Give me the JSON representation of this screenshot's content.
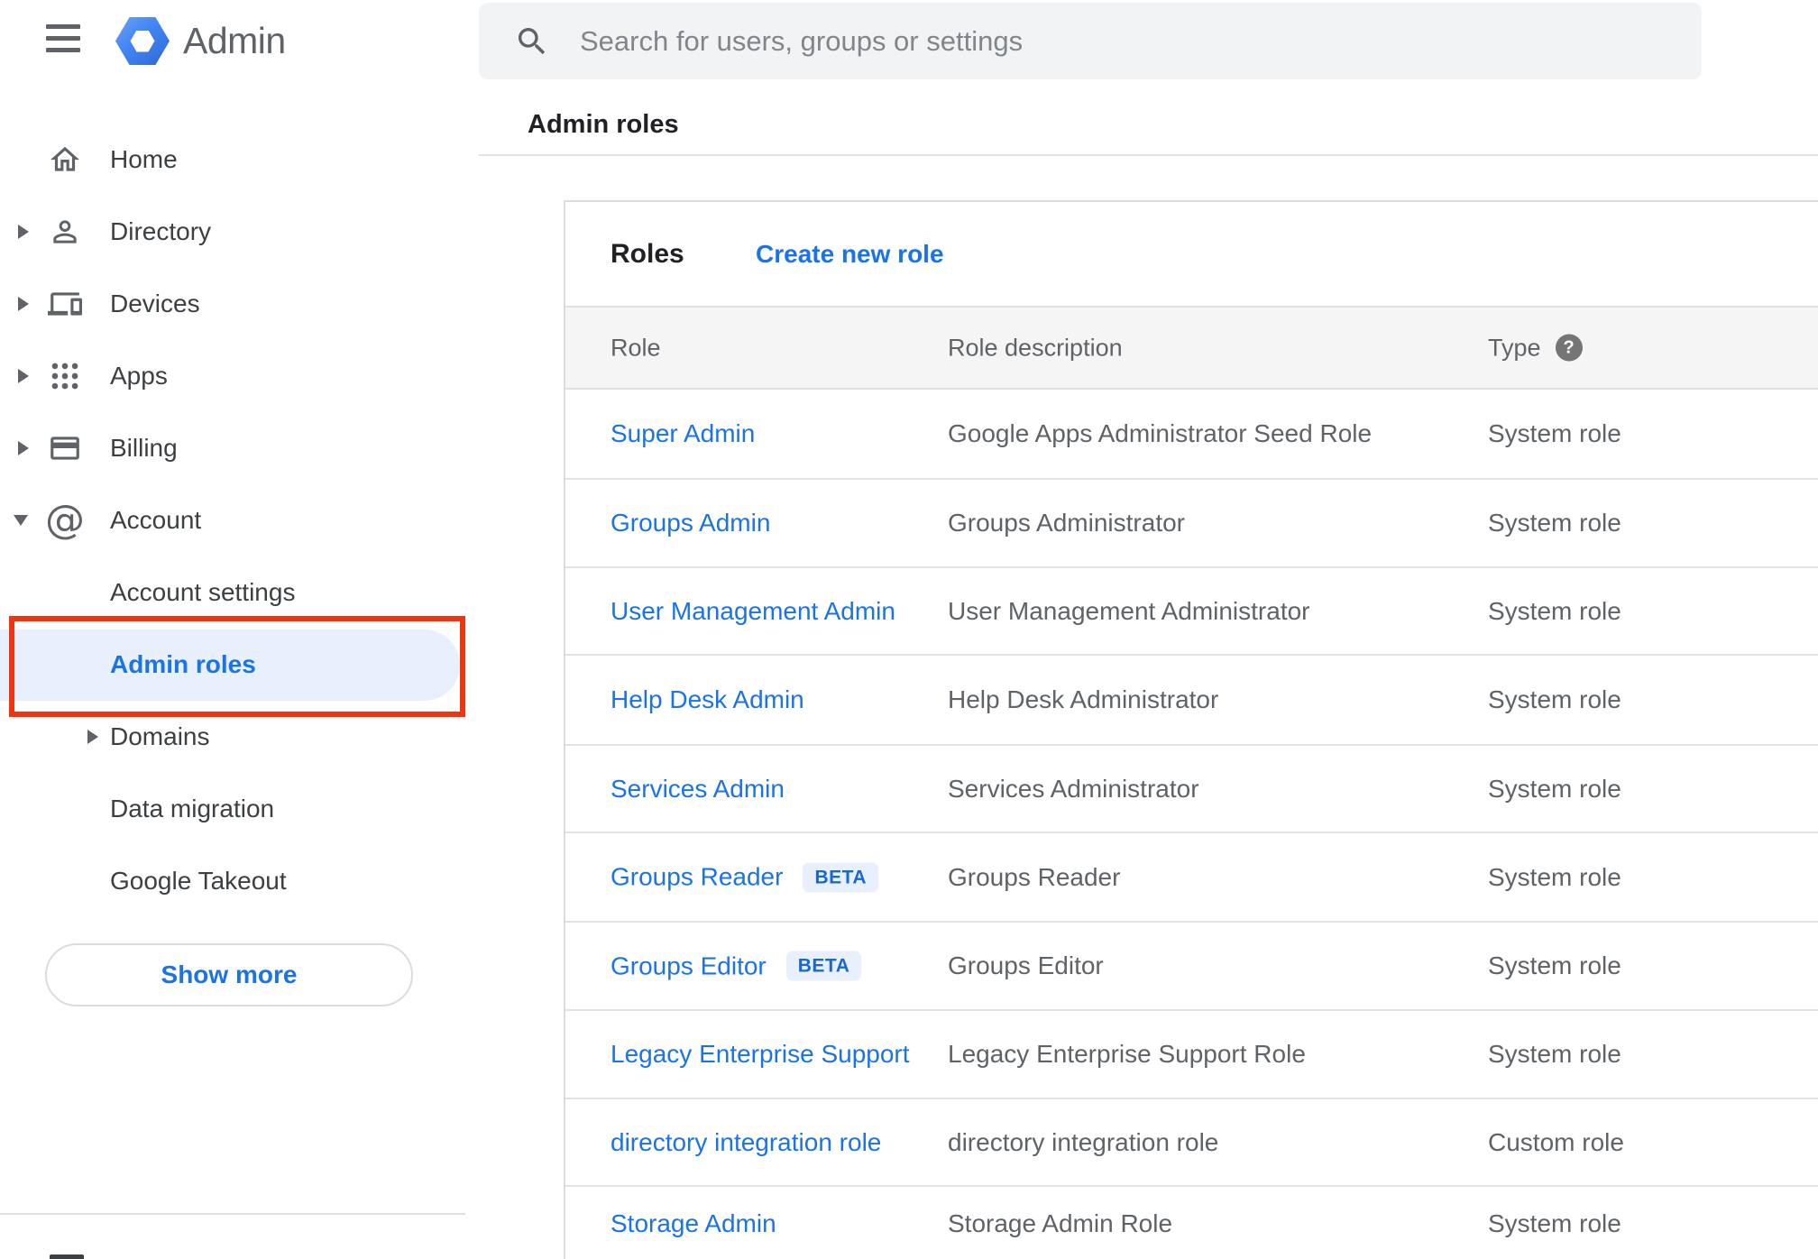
{
  "topbar": {
    "app_title": "Admin",
    "search_placeholder": "Search for users, groups or settings"
  },
  "breadcrumb": "Admin roles",
  "sidebar": {
    "items": [
      {
        "label": "Home"
      },
      {
        "label": "Directory"
      },
      {
        "label": "Devices"
      },
      {
        "label": "Apps"
      },
      {
        "label": "Billing"
      },
      {
        "label": "Account"
      },
      {
        "label": "Account settings"
      },
      {
        "label": "Admin roles"
      },
      {
        "label": "Domains"
      },
      {
        "label": "Data migration"
      },
      {
        "label": "Google Takeout"
      }
    ],
    "show_more_label": "Show more"
  },
  "roles_card": {
    "title": "Roles",
    "create_link": "Create new role",
    "columns": {
      "role": "Role",
      "description": "Role description",
      "type": "Type"
    },
    "help_glyph": "?",
    "beta_label": "BETA",
    "rows": [
      {
        "role": "Super Admin",
        "description": "Google Apps Administrator Seed Role",
        "type": "System role"
      },
      {
        "role": "Groups Admin",
        "description": "Groups Administrator",
        "type": "System role"
      },
      {
        "role": "User Management Admin",
        "description": "User Management Administrator",
        "type": "System role"
      },
      {
        "role": "Help Desk Admin",
        "description": "Help Desk Administrator",
        "type": "System role"
      },
      {
        "role": "Services Admin",
        "description": "Services Administrator",
        "type": "System role"
      },
      {
        "role": "Groups Reader",
        "description": "Groups Reader",
        "type": "System role",
        "beta": true
      },
      {
        "role": "Groups Editor",
        "description": "Groups Editor",
        "type": "System role",
        "beta": true
      },
      {
        "role": "Legacy Enterprise Support",
        "description": "Legacy Enterprise Support Role",
        "type": "System role"
      },
      {
        "role": "directory integration role",
        "description": "directory integration role",
        "type": "Custom role"
      },
      {
        "role": "Storage Admin",
        "description": "Storage Admin Role",
        "type": "System role"
      }
    ]
  },
  "colors": {
    "accent_blue": "#1a73e8",
    "annotation_red": "#ed3511",
    "selected_bg": "#e8f0fe",
    "beta_bg": "#e8f0fe",
    "beta_text": "#1967d2"
  }
}
